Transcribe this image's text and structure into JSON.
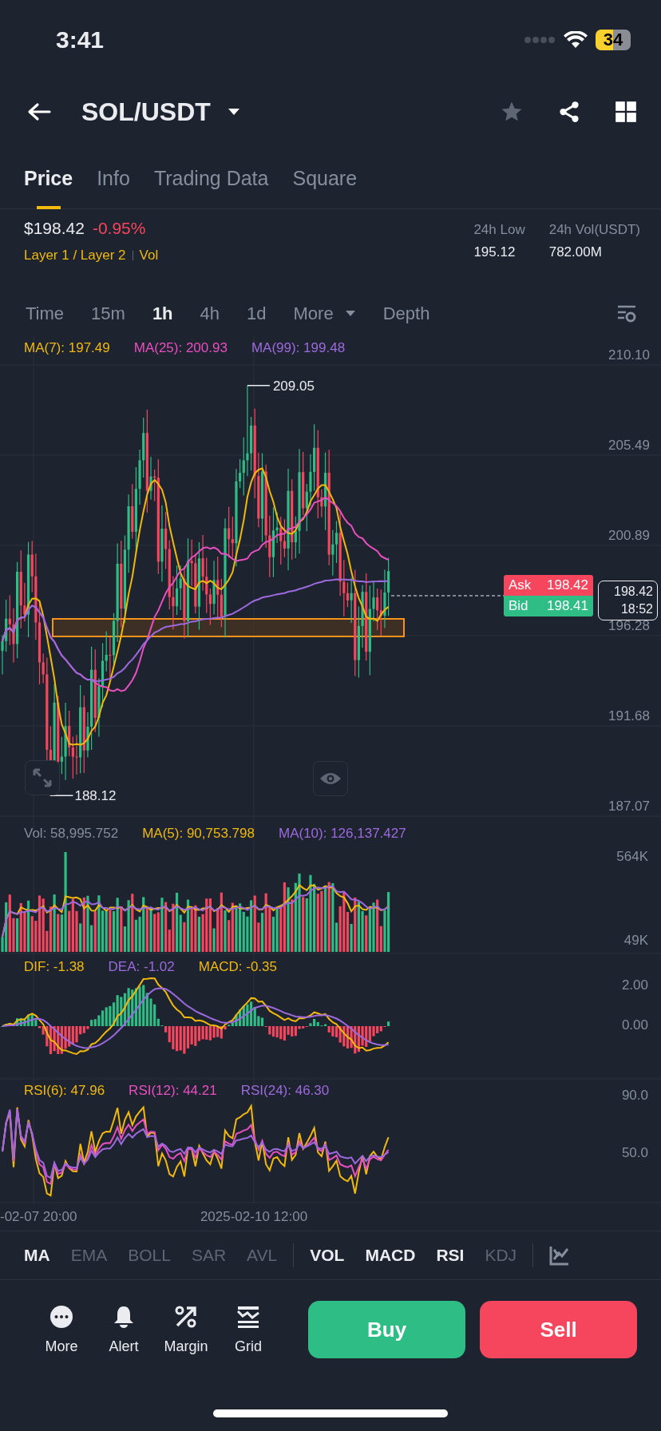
{
  "status_bar": {
    "time": "3:41",
    "battery": "34"
  },
  "header": {
    "pair": "SOL/USDT"
  },
  "tabs": [
    {
      "label": "Price",
      "selected": true
    },
    {
      "label": "Info",
      "selected": false
    },
    {
      "label": "Trading Data",
      "selected": false
    },
    {
      "label": "Square",
      "selected": false
    }
  ],
  "price": {
    "last": "$198.42",
    "change": "-0.95%",
    "tags": [
      "Layer 1 / Layer 2",
      "Vol"
    ]
  },
  "stats": [
    {
      "label": "24h Low",
      "value": "195.12"
    },
    {
      "label": "24h Vol(USDT)",
      "value": "782.00M"
    }
  ],
  "intervals": [
    {
      "label": "Time",
      "selected": false,
      "kind": "plain"
    },
    {
      "label": "15m",
      "selected": false,
      "kind": "plain"
    },
    {
      "label": "1h",
      "selected": true,
      "kind": "plain"
    },
    {
      "label": "4h",
      "selected": false,
      "kind": "plain"
    },
    {
      "label": "1d",
      "selected": false,
      "kind": "plain"
    },
    {
      "label": "More",
      "selected": false,
      "kind": "dropdown"
    },
    {
      "label": "Depth",
      "selected": false,
      "kind": "plain"
    }
  ],
  "main_chart": {
    "legend": [
      {
        "text": "MA(7): 197.49",
        "color": "#f0b90b"
      },
      {
        "text": "MA(25): 200.93",
        "color": "#e84fc0"
      },
      {
        "text": "MA(99): 199.48",
        "color": "#9c6ade"
      }
    ],
    "axis_labels": [
      "210.10",
      "205.49",
      "200.89",
      "196.28",
      "191.68",
      "187.07"
    ],
    "high_label": "209.05",
    "low_label": "188.12",
    "ask": {
      "label": "Ask",
      "value": "198.42"
    },
    "bid": {
      "label": "Bid",
      "value": "198.41"
    },
    "last_price": "198.42",
    "countdown": "18:52"
  },
  "volume": {
    "legend": [
      {
        "text": "Vol: 58,995.752",
        "color": "#848e9c"
      },
      {
        "text": "MA(5): 90,753.798",
        "color": "#f0b90b"
      },
      {
        "text": "MA(10): 126,137.427",
        "color": "#9c6ade"
      }
    ],
    "axis_labels": [
      "564K",
      "49K"
    ]
  },
  "macd": {
    "legend": [
      {
        "text": "DIF: -1.38",
        "color": "#f0b90b"
      },
      {
        "text": "DEA: -1.02",
        "color": "#9c6ade"
      },
      {
        "text": "MACD: -0.35",
        "color": "#f0b90b"
      }
    ],
    "axis_labels": [
      "2.00",
      "0.00"
    ]
  },
  "rsi": {
    "legend": [
      {
        "text": "RSI(6): 47.96",
        "color": "#f0b90b"
      },
      {
        "text": "RSI(12): 44.21",
        "color": "#e84fc0"
      },
      {
        "text": "RSI(24): 46.30",
        "color": "#9c6ade"
      }
    ],
    "axis_labels": [
      "90.0",
      "50.0"
    ]
  },
  "time_axis": [
    "-02-07 20:00",
    "2025-02-10 12:00"
  ],
  "indicators": [
    {
      "label": "MA",
      "active": true
    },
    {
      "label": "EMA",
      "active": false
    },
    {
      "label": "BOLL",
      "active": false
    },
    {
      "label": "SAR",
      "active": false
    },
    {
      "label": "AVL",
      "active": false
    },
    {
      "label": "VOL",
      "active": true
    },
    {
      "label": "MACD",
      "active": true
    },
    {
      "label": "RSI",
      "active": true
    },
    {
      "label": "KDJ",
      "active": false
    }
  ],
  "actions": [
    {
      "label": "More",
      "kind": "more"
    },
    {
      "label": "Alert",
      "kind": "alert"
    },
    {
      "label": "Margin",
      "kind": "margin"
    },
    {
      "label": "Grid",
      "kind": "grid"
    }
  ],
  "trade_buttons": [
    {
      "label": "Buy",
      "kind": "buy"
    },
    {
      "label": "Sell",
      "kind": "sell"
    }
  ]
}
